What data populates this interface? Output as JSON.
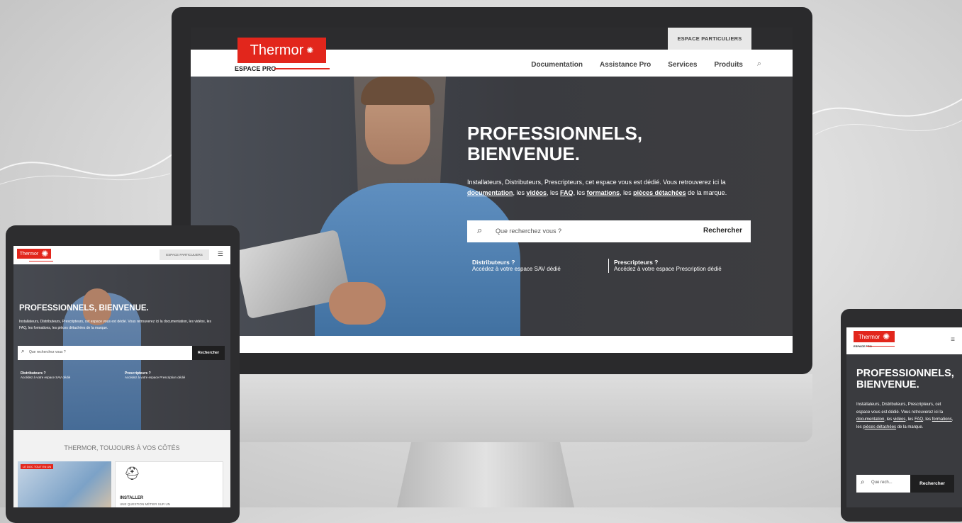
{
  "brand": {
    "logo_text": "Thermor",
    "sub_label": "ESPACE PRO",
    "accent": "#e2261c"
  },
  "desktop": {
    "espace_particuliers": "ESPACE PARTICULIERS",
    "menu": [
      "Documentation",
      "Assistance Pro",
      "Services",
      "Produits"
    ],
    "hero_title_line1": "PROFESSIONNELS,",
    "hero_title_line2": "BIENVENUE.",
    "intro_1": "Installateurs, Distributeurs, Prescripteurs, cet espace vous est dédié. Vous retrouverez ici la ",
    "intro_links": [
      "documentation",
      "vidéos",
      "FAQ",
      "formations",
      "pièces détachées"
    ],
    "intro_end": " de la marque.",
    "search_placeholder": "Que recherchez vous ?",
    "search_button": "Rechercher",
    "distributeurs_title": "Distributeurs ?",
    "distributeurs_text": "Accédez à votre espace SAV dédié",
    "prescripteurs_title": "Prescripteurs ?",
    "prescripteurs_text": "Accédez à votre espace Prescription dédié"
  },
  "tablet": {
    "espace_particuliers": "ESPACE PARTICULIERS",
    "hero_title": "PROFESSIONNELS, BIENVENUE.",
    "intro": "Installateurs, Distributeurs, Prescripteurs, cet espace vous est dédié. Vous retrouverez ici la documentation, les vidéos, les FAQ, les formations, les pièces détachées de la marque.",
    "search_placeholder": "Que recherchez vous ?",
    "search_button": "Rechercher",
    "distributeurs_title": "Distributeurs ?",
    "distributeurs_text": "Accédez à votre espace SAV dédié",
    "prescripteurs_title": "Prescripteurs ?",
    "prescripteurs_text": "Accédez à votre espace Prescription dédié",
    "section_title": "THERMOR, TOUJOURS À VOS CÔTÉS",
    "card_tag": "LE DOC TOUT EN UN",
    "card_heading": "INSTALLER",
    "card_text": "UNE QUESTION MÉTIER SUR UN"
  },
  "phone": {
    "hero_title": "PROFESSIONNELS, BIENVENUE.",
    "intro_plain_1": "Installateurs, Distributeurs, Prescripteurs, cet espace vous est dédié. Vous retrouverez ici la ",
    "intro_links": [
      "documentation",
      "vidéos",
      "FAQ",
      "formations",
      "pièces détachées"
    ],
    "search_placeholder": "Que rech...",
    "search_button": "Rechercher"
  }
}
